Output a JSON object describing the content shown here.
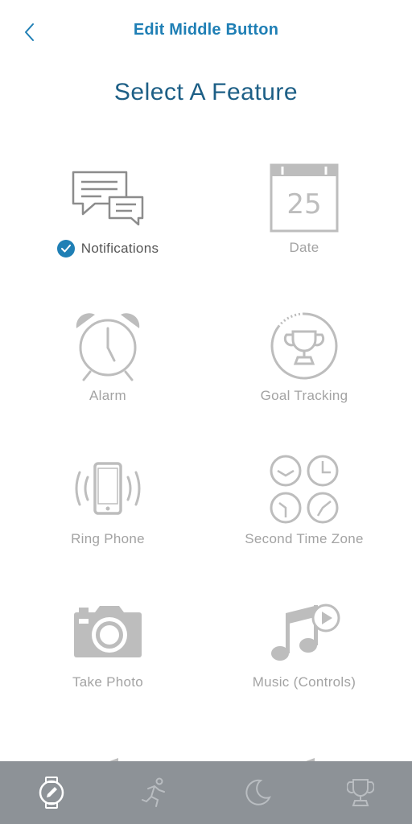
{
  "header": {
    "title": "Edit Middle Button",
    "back_icon": "chevron-left-icon"
  },
  "page": {
    "section_title": "Select A Feature"
  },
  "colors": {
    "accent": "#1f7fb5",
    "title": "#1d5f86",
    "icon_gray": "#b8b8b8",
    "tabbar_bg": "#8d9297"
  },
  "features": [
    {
      "label": "Notifications",
      "icon": "notifications-icon",
      "selected": true
    },
    {
      "label": "Date",
      "icon": "calendar-icon",
      "calendar_day": "25"
    },
    {
      "label": "Alarm",
      "icon": "alarm-clock-icon"
    },
    {
      "label": "Goal Tracking",
      "icon": "trophy-icon"
    },
    {
      "label": "Ring Phone",
      "icon": "ring-phone-icon"
    },
    {
      "label": "Second Time Zone",
      "icon": "time-zones-icon"
    },
    {
      "label": "Take Photo",
      "icon": "camera-icon"
    },
    {
      "label": "Music (Controls)",
      "icon": "music-icon"
    }
  ],
  "tabbar": {
    "tabs": [
      {
        "icon": "watch-edit-icon",
        "active": true
      },
      {
        "icon": "runner-icon"
      },
      {
        "icon": "moon-icon"
      },
      {
        "icon": "trophy-icon"
      }
    ]
  }
}
